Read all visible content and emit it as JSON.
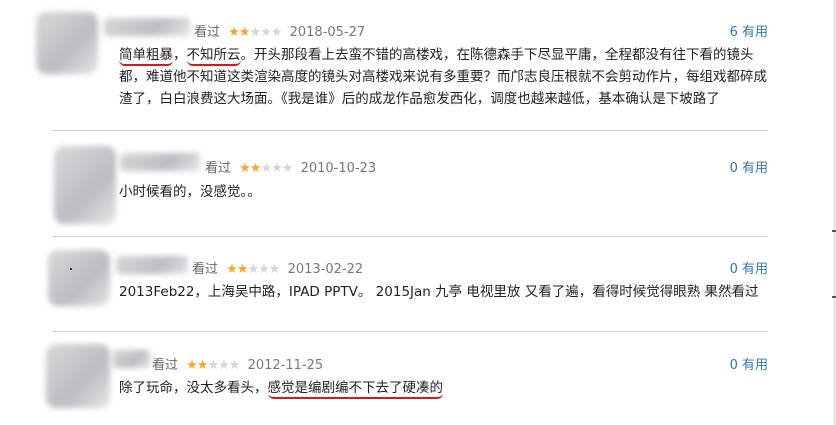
{
  "reviews": [
    {
      "watched": "看过",
      "date": "2018-05-27",
      "useful_count": "6",
      "useful_label": "有用",
      "text_hl1": "简单粗暴",
      "text_mid1": "，",
      "text_hl2": "不知所云",
      "text_rest": "。开头那段看上去蛮不错的高楼戏，在陈德森手下尽显平庸，全程都没有往下看的镜头都，难道他不知道这类渲染高度的镜头对高楼戏来说有多重要？而邝志良压根就不会剪动作片，每组戏都碎成渣了，白白浪费这大场面。《我是谁》后的成龙作品愈发西化，调度也越来越低，基本确认是下坡路了"
    },
    {
      "watched": "看过",
      "date": "2010-10-23",
      "useful_count": "0",
      "useful_label": "有用",
      "text": "小时候看的，没感觉。。"
    },
    {
      "watched": "看过",
      "date": "2013-02-22",
      "useful_count": "0",
      "useful_label": "有用",
      "text": "2013Feb22，上海吴中路，IPAD PPTV。 2015Jan 九亭 电视里放 又看了遍，看得时候觉得眼熟 果然看过"
    },
    {
      "watched": "看过",
      "date": "2012-11-25",
      "useful_count": "0",
      "useful_label": "有用",
      "text_plain": "除了玩命，没太多看头，",
      "text_hl": "感觉是编剧编不下去了硬凑的"
    }
  ],
  "colors": {
    "star_on": "#f4a72a",
    "star_off": "#d6d6d6",
    "link": "#3377aa",
    "underline": "#d21a1a"
  },
  "rating_stars": 2
}
